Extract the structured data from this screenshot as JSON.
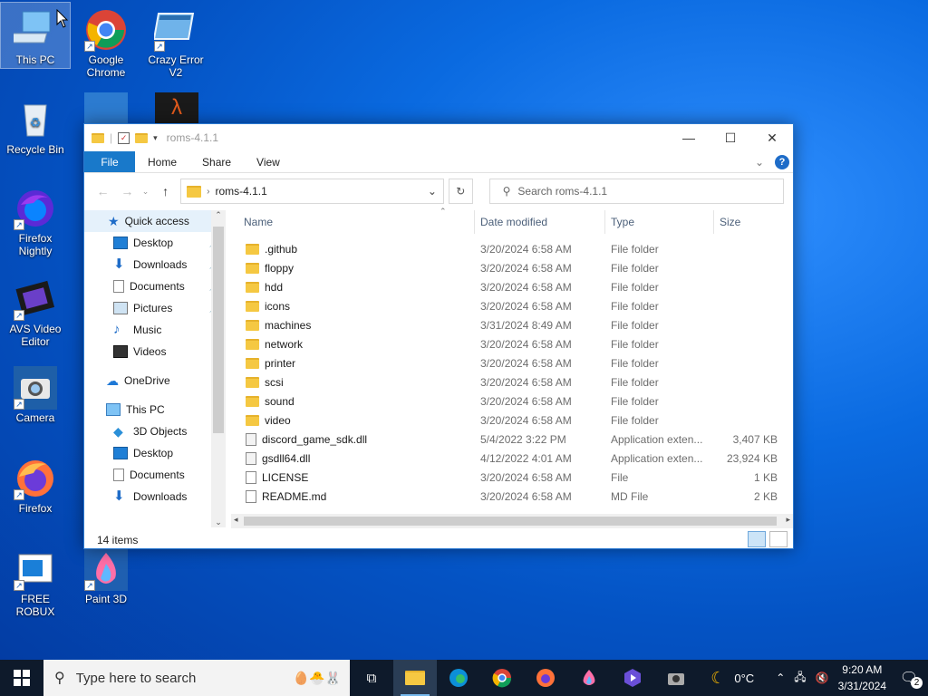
{
  "desktop": {
    "icons": [
      {
        "label": "This PC",
        "icon": "this-pc-icon"
      },
      {
        "label": "Google Chrome",
        "icon": "chrome-icon"
      },
      {
        "label": "Crazy Error V2",
        "icon": "error-window-icon"
      },
      {
        "label": "Recycle Bin",
        "icon": "recycle-bin-icon"
      },
      {
        "label": "Firefox Nightly",
        "icon": "firefox-nightly-icon"
      },
      {
        "label": "AVS Video Editor",
        "icon": "film-strip-icon"
      },
      {
        "label": "Camera",
        "icon": "camera-icon"
      },
      {
        "label": "Firefox",
        "icon": "firefox-icon"
      },
      {
        "label": "FREE ROBUX",
        "icon": "window-icon"
      },
      {
        "label": "Paint 3D",
        "icon": "paint3d-icon"
      }
    ]
  },
  "explorer": {
    "title": "roms-4.1.1",
    "ribbon_tabs": [
      "File",
      "Home",
      "Share",
      "View"
    ],
    "address": "roms-4.1.1",
    "search_placeholder": "Search roms-4.1.1",
    "nav": {
      "quick_access": "Quick access",
      "items": [
        "Desktop",
        "Downloads",
        "Documents",
        "Pictures",
        "Music",
        "Videos"
      ],
      "onedrive": "OneDrive",
      "this_pc": "This PC",
      "pc_items": [
        "3D Objects",
        "Desktop",
        "Documents",
        "Downloads"
      ]
    },
    "columns": [
      "Name",
      "Date modified",
      "Type",
      "Size"
    ],
    "files": [
      {
        "name": ".github",
        "date": "3/20/2024 6:58 AM",
        "type": "File folder",
        "size": "",
        "kind": "folder"
      },
      {
        "name": "floppy",
        "date": "3/20/2024 6:58 AM",
        "type": "File folder",
        "size": "",
        "kind": "folder"
      },
      {
        "name": "hdd",
        "date": "3/20/2024 6:58 AM",
        "type": "File folder",
        "size": "",
        "kind": "folder"
      },
      {
        "name": "icons",
        "date": "3/20/2024 6:58 AM",
        "type": "File folder",
        "size": "",
        "kind": "folder"
      },
      {
        "name": "machines",
        "date": "3/31/2024 8:49 AM",
        "type": "File folder",
        "size": "",
        "kind": "folder"
      },
      {
        "name": "network",
        "date": "3/20/2024 6:58 AM",
        "type": "File folder",
        "size": "",
        "kind": "folder"
      },
      {
        "name": "printer",
        "date": "3/20/2024 6:58 AM",
        "type": "File folder",
        "size": "",
        "kind": "folder"
      },
      {
        "name": "scsi",
        "date": "3/20/2024 6:58 AM",
        "type": "File folder",
        "size": "",
        "kind": "folder"
      },
      {
        "name": "sound",
        "date": "3/20/2024 6:58 AM",
        "type": "File folder",
        "size": "",
        "kind": "folder"
      },
      {
        "name": "video",
        "date": "3/20/2024 6:58 AM",
        "type": "File folder",
        "size": "",
        "kind": "folder"
      },
      {
        "name": "discord_game_sdk.dll",
        "date": "5/4/2022 3:22 PM",
        "type": "Application exten...",
        "size": "3,407 KB",
        "kind": "dll"
      },
      {
        "name": "gsdll64.dll",
        "date": "4/12/2022 4:01 AM",
        "type": "Application exten...",
        "size": "23,924 KB",
        "kind": "dll"
      },
      {
        "name": "LICENSE",
        "date": "3/20/2024 6:58 AM",
        "type": "File",
        "size": "1 KB",
        "kind": "file"
      },
      {
        "name": "README.md",
        "date": "3/20/2024 6:58 AM",
        "type": "MD File",
        "size": "2 KB",
        "kind": "file"
      }
    ],
    "status": "14 items"
  },
  "taskbar": {
    "search_placeholder": "Type here to search",
    "weather": "0°C",
    "time": "9:20 AM",
    "date": "3/31/2024",
    "notification_count": "2"
  }
}
